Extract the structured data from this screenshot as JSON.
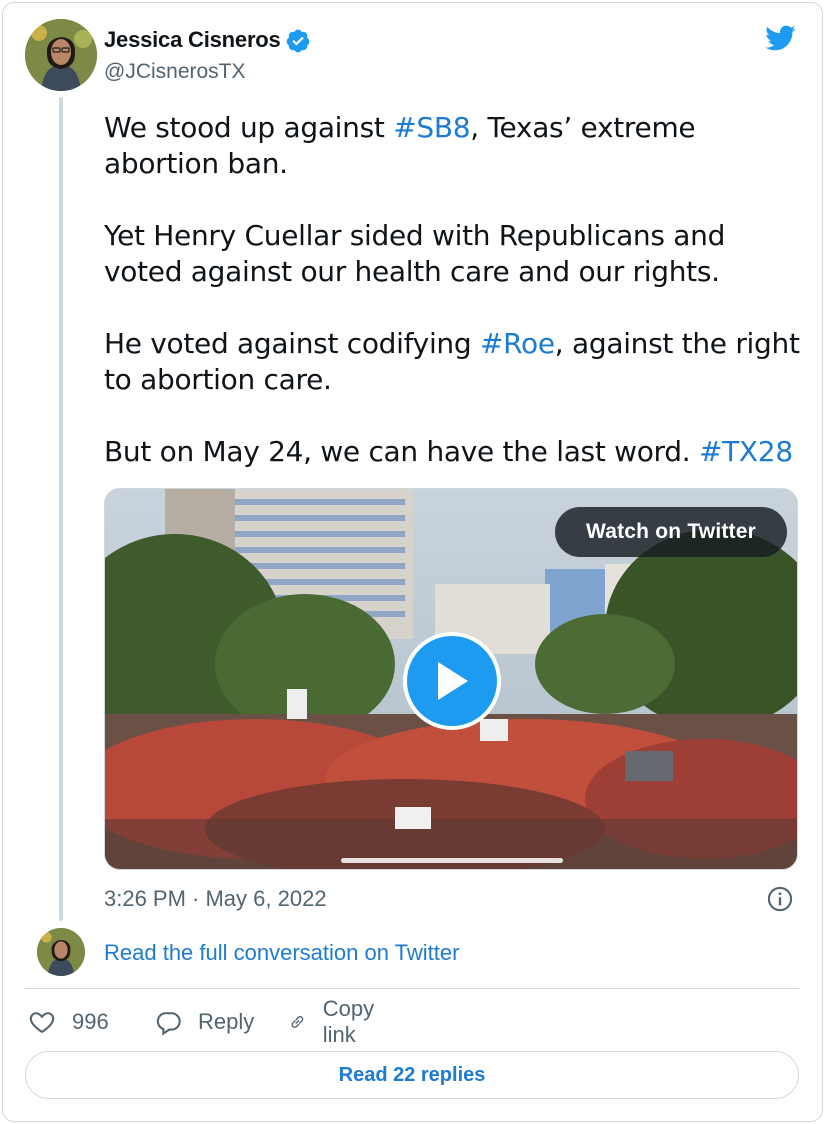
{
  "author": {
    "name": "Jessica Cisneros",
    "handle": "@JCisnerosTX",
    "verified": true
  },
  "tweet": {
    "paragraphs": [
      [
        {
          "text": "We stood up against "
        },
        {
          "text": "#SB8",
          "hashtag": true
        },
        {
          "text": ", Texas’ extreme abortion ban."
        }
      ],
      [
        {
          "text": "Yet Henry Cuellar sided with Republicans and voted against our health care and our rights."
        }
      ],
      [
        {
          "text": "He voted against codifying "
        },
        {
          "text": "#Roe",
          "hashtag": true
        },
        {
          "text": ", against the right to abortion care."
        }
      ],
      [
        {
          "text": "But on May 24, we can have the last word. "
        },
        {
          "text": "#TX28",
          "hashtag": true
        }
      ]
    ],
    "timestamp": "3:26 PM · May 6, 2022"
  },
  "media": {
    "watch_label": "Watch on Twitter"
  },
  "conversation_link": "Read the full conversation on Twitter",
  "actions": {
    "like_count": "996",
    "reply_label": "Reply",
    "copy_link_label": "Copy link"
  },
  "read_replies_label": "Read 22 replies",
  "colors": {
    "accent": "#1d9bf0",
    "link": "#1d7bd3",
    "secondary_text": "#536471",
    "border": "#cfd9de"
  },
  "icons": [
    "verified-badge-icon",
    "twitter-bird-icon",
    "play-icon",
    "info-icon",
    "heart-icon",
    "reply-icon",
    "link-icon"
  ]
}
